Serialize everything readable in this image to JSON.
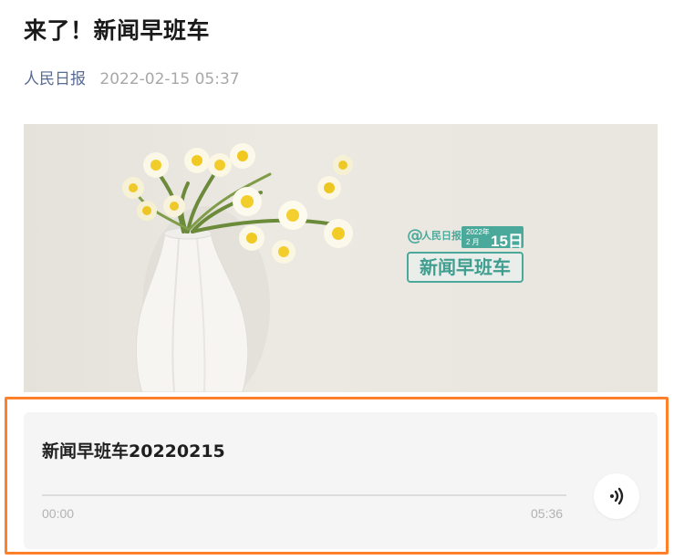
{
  "article": {
    "title": "来了！新闻早班车",
    "source": "人民日报",
    "date": "2022-02-15 05:37"
  },
  "hero": {
    "logo_brand": "人民日报",
    "logo_year": "2022年",
    "logo_month": "2 月",
    "logo_day": "15日",
    "logo_word": "新闻早班车",
    "icons": [
      "vase-image",
      "daffodil-flowers"
    ]
  },
  "audio": {
    "title": "新闻早班车20220215",
    "current_time": "00:00",
    "duration": "05:36",
    "progress": 0,
    "icon": "audio-wave-icon"
  },
  "colors": {
    "source_link": "#576b95",
    "highlight": "#ff7f2a",
    "brand_green": "#4aa99a"
  }
}
